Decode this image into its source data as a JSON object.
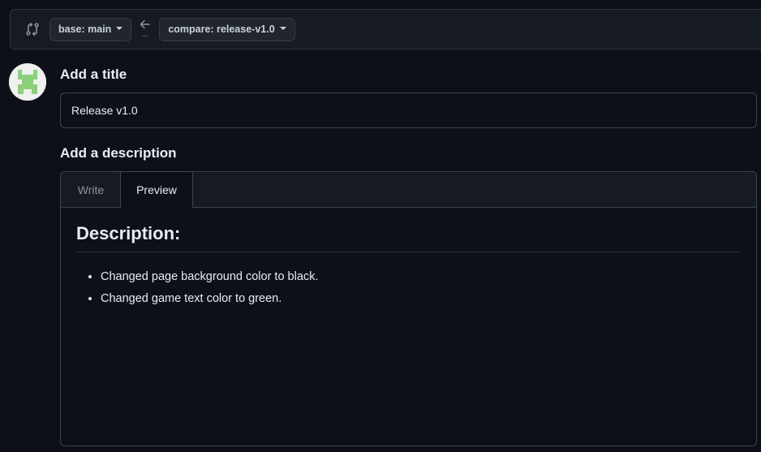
{
  "compare_bar": {
    "icon": "git-compare-icon",
    "base_label": "base: main",
    "direction_icon": "arrow-left-icon",
    "ellipsis": "...",
    "compare_label": "compare: release-v1.0"
  },
  "avatar": {
    "icon": "pixel-avatar-icon",
    "color": "#8bd17c"
  },
  "title_section": {
    "label": "Add a title",
    "value": "Release v1.0"
  },
  "description_section": {
    "label": "Add a description",
    "tabs": [
      {
        "label": "Write",
        "active": false
      },
      {
        "label": "Preview",
        "active": true
      }
    ],
    "preview": {
      "heading": "Description:",
      "items": [
        "Changed page background color to black.",
        "Changed game text color to green."
      ]
    }
  }
}
